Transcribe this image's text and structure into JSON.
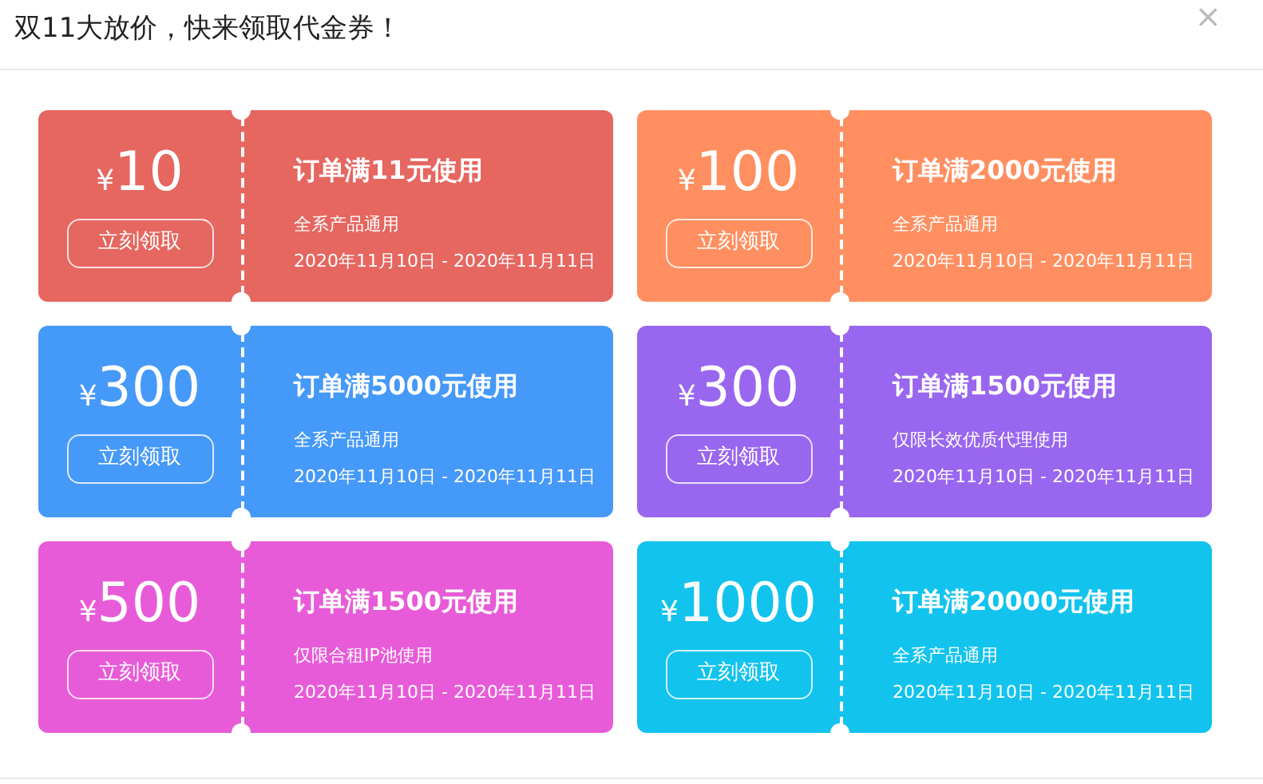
{
  "dialog": {
    "title": "双11大放价，快来领取代金券！",
    "close": "×"
  },
  "coupons": [
    {
      "currency": "¥",
      "amount": "10",
      "button": "立刻领取",
      "condition": "订单满11元使用",
      "scope": "全系产品通用",
      "validity": "2020年11月10日 - 2020年11月11日",
      "color": "#e66660"
    },
    {
      "currency": "¥",
      "amount": "100",
      "button": "立刻领取",
      "condition": "订单满2000元使用",
      "scope": "全系产品通用",
      "validity": "2020年11月10日 - 2020年11月11日",
      "color": "#ff8f60"
    },
    {
      "currency": "¥",
      "amount": "300",
      "button": "立刻领取",
      "condition": "订单满5000元使用",
      "scope": "全系产品通用",
      "validity": "2020年11月10日 - 2020年11月11日",
      "color": "#4599f8"
    },
    {
      "currency": "¥",
      "amount": "300",
      "button": "立刻领取",
      "condition": "订单满1500元使用",
      "scope": "仅限长效优质代理使用",
      "validity": "2020年11月10日 - 2020年11月11日",
      "color": "#9966f0"
    },
    {
      "currency": "¥",
      "amount": "500",
      "button": "立刻领取",
      "condition": "订单满1500元使用",
      "scope": "仅限合租IP池使用",
      "validity": "2020年11月10日 - 2020年11月11日",
      "color": "#e85bd8"
    },
    {
      "currency": "¥",
      "amount": "1000",
      "button": "立刻领取",
      "condition": "订单满20000元使用",
      "scope": "全系产品通用",
      "validity": "2020年11月10日 - 2020年11月11日",
      "color": "#12c3ee"
    }
  ]
}
